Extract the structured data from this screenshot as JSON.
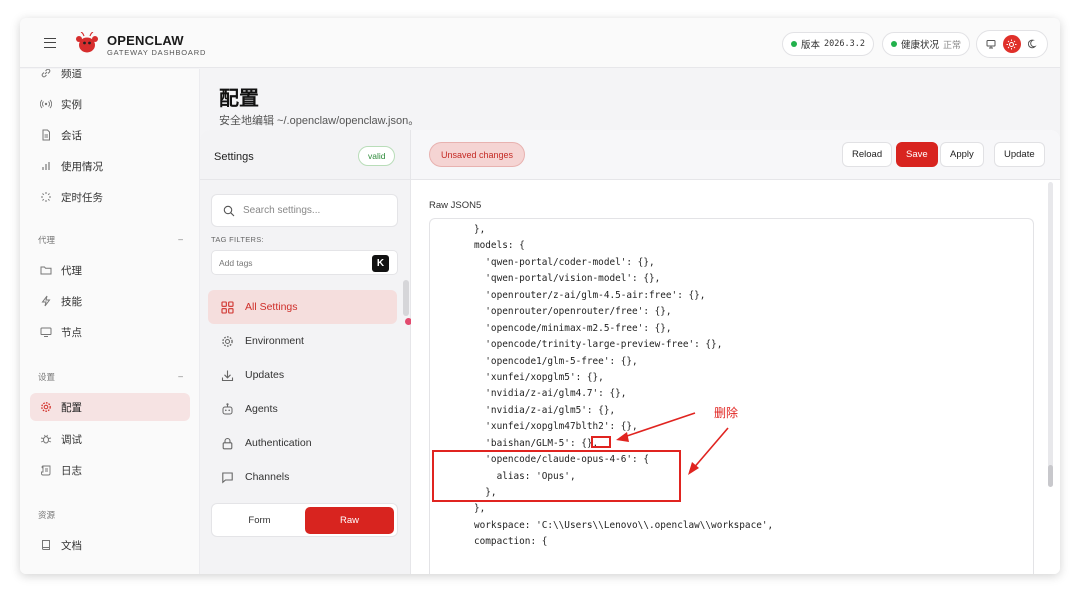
{
  "header": {
    "brand_name": "OPENCLAW",
    "brand_sub": "GATEWAY DASHBOARD",
    "version_label": "版本",
    "version_value": "2026.3.2",
    "health_label": "健康状况",
    "health_value": "正常"
  },
  "nav": {
    "items_top": [
      {
        "label": "频道",
        "icon": "link-icon"
      },
      {
        "label": "实例",
        "icon": "radio-icon"
      },
      {
        "label": "会话",
        "icon": "document-icon"
      },
      {
        "label": "使用情况",
        "icon": "bar-chart-icon"
      },
      {
        "label": "定时任务",
        "icon": "loader-icon"
      }
    ],
    "section_agents": "代理",
    "items_agents": [
      {
        "label": "代理",
        "icon": "folder-icon"
      },
      {
        "label": "技能",
        "icon": "zap-icon"
      },
      {
        "label": "节点",
        "icon": "monitor-icon"
      }
    ],
    "section_settings": "设置",
    "items_settings": [
      {
        "label": "配置",
        "icon": "gear-icon",
        "active": true
      },
      {
        "label": "调试",
        "icon": "bug-icon"
      },
      {
        "label": "日志",
        "icon": "scroll-icon"
      }
    ],
    "section_resources": "资源",
    "items_resources": [
      {
        "label": "文档",
        "icon": "book-icon"
      }
    ]
  },
  "page": {
    "title": "配置",
    "subtitle": "安全地编辑 ~/.openclaw/openclaw.json。"
  },
  "settings": {
    "title": "Settings",
    "valid_badge": "valid",
    "search_placeholder": "Search settings...",
    "tag_filters_label": "TAG FILTERS:",
    "tag_placeholder": "Add tags",
    "tag_button": "K",
    "sections": [
      {
        "label": "All Settings",
        "icon": "grid-icon",
        "active": true
      },
      {
        "label": "Environment",
        "icon": "gear-icon"
      },
      {
        "label": "Updates",
        "icon": "download-icon"
      },
      {
        "label": "Agents",
        "icon": "robot-icon"
      },
      {
        "label": "Authentication",
        "icon": "lock-icon"
      },
      {
        "label": "Channels",
        "icon": "chat-icon"
      }
    ],
    "mode_form": "Form",
    "mode_raw": "Raw"
  },
  "toolbar": {
    "unsaved": "Unsaved changes",
    "reload": "Reload",
    "save": "Save",
    "apply": "Apply",
    "update": "Update"
  },
  "editor": {
    "label": "Raw JSON5",
    "lines": [
      "},",
      "models: {",
      "  'qwen-portal/coder-model': {},",
      "  'qwen-portal/vision-model': {},",
      "  'openrouter/z-ai/glm-4.5-air:free': {},",
      "  'openrouter/openrouter/free': {},",
      "  'opencode/minimax-m2.5-free': {},",
      "  'opencode/trinity-large-preview-free': {},",
      "  'opencode1/glm-5-free': {},",
      "  'xunfei/xopglm5': {},",
      "  'nvidia/z-ai/glm4.7': {},",
      "  'nvidia/z-ai/glm5': {},",
      "  'xunfei/xopglm47blth2': {},",
      "  'baishan/GLM-5': {},",
      "  'opencode/claude-opus-4-6': {",
      "    alias: 'Opus',",
      "  },",
      "},",
      "workspace: 'C:\\\\Users\\\\Lenovo\\\\.openclaw\\\\workspace',",
      "compaction: {"
    ]
  },
  "annotation": {
    "text": "删除",
    "color": "#e02420"
  }
}
